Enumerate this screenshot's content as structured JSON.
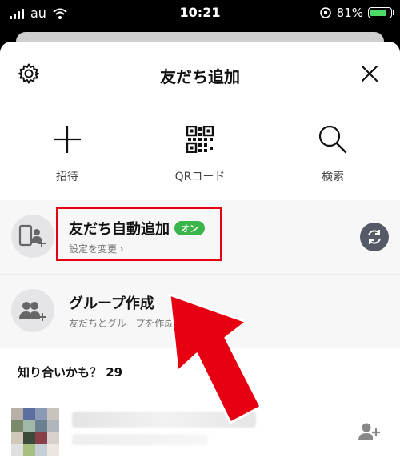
{
  "status_bar": {
    "carrier": "au",
    "time": "10:21",
    "battery_percent": "81%",
    "battery_level": 0.81
  },
  "header": {
    "title": "友だち追加",
    "settings_icon": "gear-icon",
    "close_icon": "close-icon"
  },
  "actions": [
    {
      "label": "招待",
      "icon": "plus-icon"
    },
    {
      "label": "QRコード",
      "icon": "qr-code-icon"
    },
    {
      "label": "検索",
      "icon": "search-icon"
    }
  ],
  "auto_add": {
    "title": "友だち自動追加",
    "badge": "オン",
    "sub": "設定を変更 ›"
  },
  "group": {
    "title": "グループ作成",
    "sub": "友だちとグループを作成"
  },
  "suggestions": {
    "label": "知り合いかも？ 29"
  },
  "colors": {
    "highlight": "#e60012",
    "badge_green": "#3bb54a",
    "sync_button": "#555a66"
  }
}
